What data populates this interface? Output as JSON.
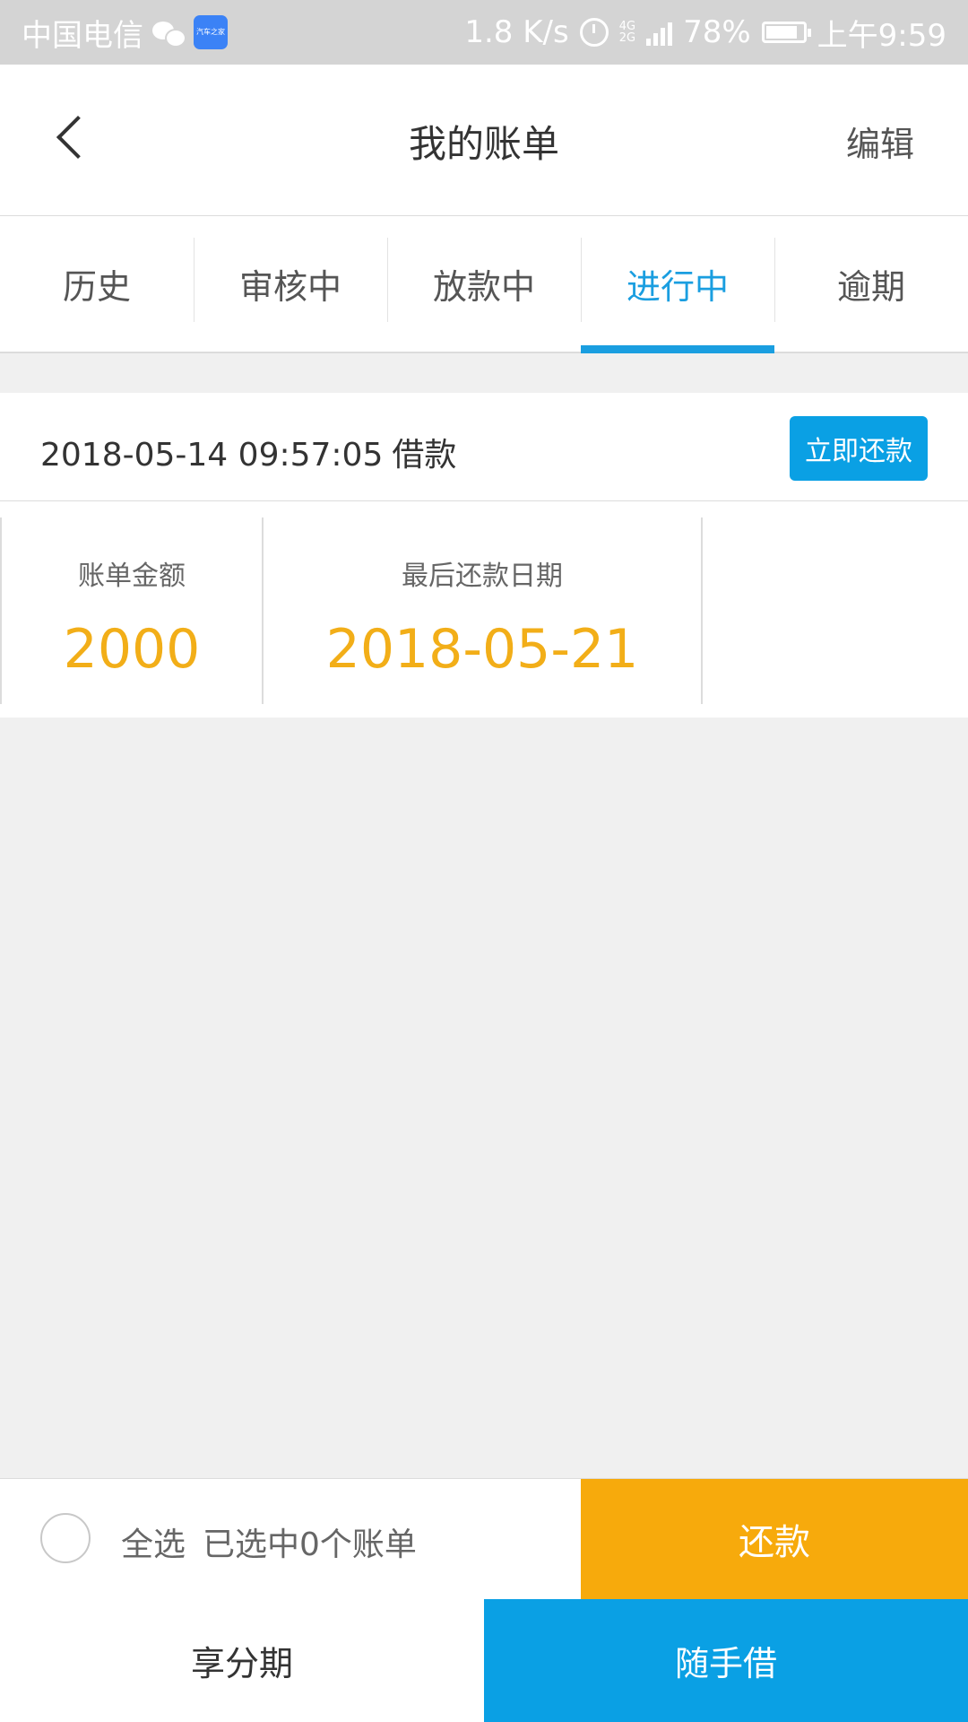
{
  "status_bar": {
    "carrier": "中国电信",
    "app_icon_text": "汽车之家",
    "net_speed": "1.8 K/s",
    "network_top": "4G",
    "network_bottom": "2G",
    "battery": "78%",
    "time": "上午9:59"
  },
  "header": {
    "title": "我的账单",
    "edit_label": "编辑"
  },
  "tabs": [
    {
      "label": "历史",
      "active": false
    },
    {
      "label": "审核中",
      "active": false
    },
    {
      "label": "放款中",
      "active": false
    },
    {
      "label": "进行中",
      "active": true
    },
    {
      "label": "逾期",
      "active": false
    }
  ],
  "bill": {
    "datetime": "2018-05-14 09:57:05",
    "type": "借款",
    "repay_now_label": "立即还款",
    "amount_label": "账单金额",
    "amount_value": "2000",
    "due_label": "最后还款日期",
    "due_value": "2018-05-21"
  },
  "select_bar": {
    "select_all_label": "全选",
    "selected_text": "已选中0个账单",
    "repay_label": "还款"
  },
  "bottom_nav": {
    "installment_label": "享分期",
    "borrow_label": "随手借"
  },
  "colors": {
    "accent_blue": "#1a9ee0",
    "accent_orange": "#f7aa0c",
    "value_orange": "#f2ae18"
  }
}
